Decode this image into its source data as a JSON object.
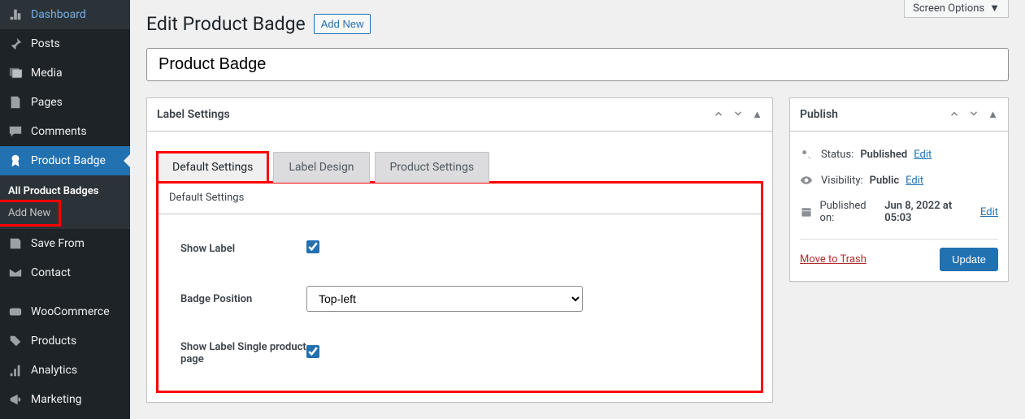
{
  "screen_options": "Screen Options",
  "sidebar": {
    "items": [
      {
        "label": "Dashboard"
      },
      {
        "label": "Posts"
      },
      {
        "label": "Media"
      },
      {
        "label": "Pages"
      },
      {
        "label": "Comments"
      },
      {
        "label": "Product Badge"
      },
      {
        "label": "Save From"
      },
      {
        "label": "Contact"
      },
      {
        "label": "WooCommerce"
      },
      {
        "label": "Products"
      },
      {
        "label": "Analytics"
      },
      {
        "label": "Marketing"
      }
    ],
    "submenu": [
      {
        "label": "All Product Badges"
      },
      {
        "label": "Add New"
      }
    ]
  },
  "header": {
    "title": "Edit Product Badge",
    "add_new": "Add New"
  },
  "title_input": "Product Badge",
  "label_box": {
    "heading": "Label Settings",
    "tabs": [
      {
        "label": "Default Settings"
      },
      {
        "label": "Label Design"
      },
      {
        "label": "Product Settings"
      }
    ],
    "section_title": "Default Settings",
    "fields": {
      "show_label": {
        "label": "Show Label",
        "checked": true
      },
      "badge_position": {
        "label": "Badge Position",
        "value": "Top-left"
      },
      "show_single": {
        "label": "Show Label Single product page",
        "checked": true
      }
    }
  },
  "publish": {
    "heading": "Publish",
    "status_prefix": "Status: ",
    "status_value": "Published",
    "visibility_prefix": "Visibility: ",
    "visibility_value": "Public",
    "published_prefix": "Published on: ",
    "published_value": "Jun 8, 2022 at 05:03",
    "edit": "Edit",
    "trash": "Move to Trash",
    "update": "Update"
  }
}
